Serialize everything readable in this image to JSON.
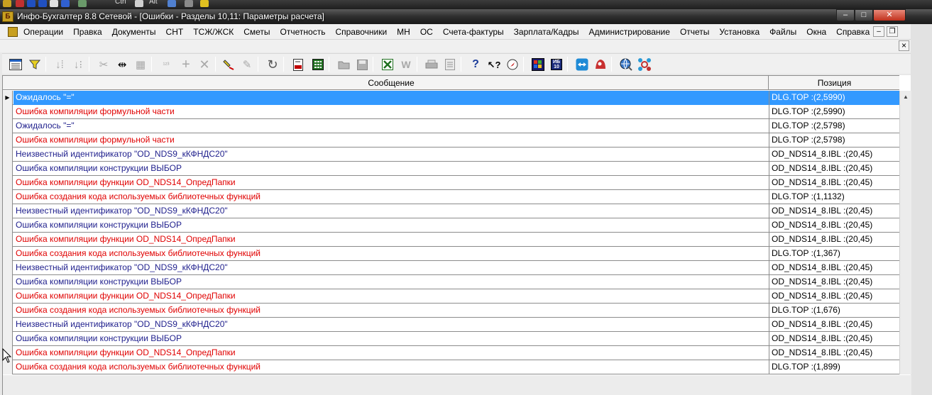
{
  "window": {
    "title": "Инфо-Бухгалтер 8.8 Сетевой - [Ошибки - Разделы 10,11: Параметры расчета]",
    "app_icon_text": "Б",
    "minimize_glyph": "–",
    "maximize_glyph": "□",
    "close_glyph": "✕"
  },
  "topstrip": {
    "items": [
      "Ctrl",
      "Alt"
    ]
  },
  "menu": {
    "items": [
      "Операции",
      "Правка",
      "Документы",
      "СНТ",
      "ТСЖ/ЖСК",
      "Сметы",
      "Отчетность",
      "Справочники",
      "МН",
      "ОС",
      "Счета-фактуры",
      "Зарплата/Кадры",
      "Администрирование",
      "Отчеты",
      "Установка",
      "Файлы",
      "Окна",
      "Справка"
    ],
    "mdi_minimize": "–",
    "mdi_restore": "❐",
    "mdi_close": "×"
  },
  "toolbar": {
    "icons": [
      "grid-view-icon",
      "filter-icon",
      "sort-asc-icon",
      "sort-desc-icon",
      "cut-icon",
      "split-icon",
      "paste-icon",
      "numbering-icon",
      "add-icon",
      "delete-icon",
      "highlight-icon",
      "clear-format-icon",
      "refresh-icon",
      "pdf-icon",
      "calculator-icon",
      "open-folder-icon",
      "save-icon",
      "excel-icon",
      "word-icon",
      "print-icon",
      "print-preview-icon",
      "help-icon",
      "whats-this-icon",
      "compass-icon",
      "windows-flag-icon",
      "ib10-icon",
      "teamviewer-icon",
      "ammy-icon",
      "globe-icon",
      "network-icon"
    ],
    "ib_label": "ИБ 10"
  },
  "grid": {
    "columns": [
      "Сообщение",
      "Позиция"
    ],
    "current_row_marker": "▶",
    "rows": [
      {
        "message": "Ожидалось \"=\"",
        "position": "DLG.TOP :(2,5990)",
        "color": "#1e1e8c",
        "selected": true
      },
      {
        "message": "Ошибка компиляции формульной части",
        "position": "DLG.TOP :(2,5990)",
        "color": "#e00000"
      },
      {
        "message": "Ожидалось \"=\"",
        "position": "DLG.TOP :(2,5798)",
        "color": "#1e1e8c"
      },
      {
        "message": "Ошибка компиляции формульной части",
        "position": "DLG.TOP :(2,5798)",
        "color": "#e00000"
      },
      {
        "message": "Неизвестный идентификатор \"OD_NDS9_кКФНДС20\"",
        "position": "OD_NDS14_8.IBL :(20,45)",
        "color": "#1e1e8c"
      },
      {
        "message": "Ошибка компиляции конструкции ВЫБОР",
        "position": "OD_NDS14_8.IBL :(20,45)",
        "color": "#1e1e8c"
      },
      {
        "message": "Ошибка компиляции функции OD_NDS14_ОпредПапки",
        "position": "OD_NDS14_8.IBL :(20,45)",
        "color": "#e00000"
      },
      {
        "message": "Ошибка создания кода используемых библиотечных функций",
        "position": "DLG.TOP :(1,1132)",
        "color": "#e00000"
      },
      {
        "message": "Неизвестный идентификатор \"OD_NDS9_кКФНДС20\"",
        "position": "OD_NDS14_8.IBL :(20,45)",
        "color": "#1e1e8c"
      },
      {
        "message": "Ошибка компиляции конструкции ВЫБОР",
        "position": "OD_NDS14_8.IBL :(20,45)",
        "color": "#1e1e8c"
      },
      {
        "message": "Ошибка компиляции функции OD_NDS14_ОпредПапки",
        "position": "OD_NDS14_8.IBL :(20,45)",
        "color": "#e00000"
      },
      {
        "message": "Ошибка создания кода используемых библиотечных функций",
        "position": "DLG.TOP :(1,367)",
        "color": "#e00000"
      },
      {
        "message": "Неизвестный идентификатор \"OD_NDS9_кКФНДС20\"",
        "position": "OD_NDS14_8.IBL :(20,45)",
        "color": "#1e1e8c"
      },
      {
        "message": "Ошибка компиляции конструкции ВЫБОР",
        "position": "OD_NDS14_8.IBL :(20,45)",
        "color": "#1e1e8c"
      },
      {
        "message": "Ошибка компиляции функции OD_NDS14_ОпредПапки",
        "position": "OD_NDS14_8.IBL :(20,45)",
        "color": "#e00000"
      },
      {
        "message": "Ошибка создания кода используемых библиотечных функций",
        "position": "DLG.TOP :(1,676)",
        "color": "#e00000"
      },
      {
        "message": "Неизвестный идентификатор \"OD_NDS9_кКФНДС20\"",
        "position": "OD_NDS14_8.IBL :(20,45)",
        "color": "#1e1e8c"
      },
      {
        "message": "Ошибка компиляции конструкции ВЫБОР",
        "position": "OD_NDS14_8.IBL :(20,45)",
        "color": "#1e1e8c"
      },
      {
        "message": "Ошибка компиляции функции OD_NDS14_ОпредПапки",
        "position": "OD_NDS14_8.IBL :(20,45)",
        "color": "#e00000"
      },
      {
        "message": "Ошибка создания кода используемых библиотечных функций",
        "position": "DLG.TOP :(1,899)",
        "color": "#e00000"
      }
    ]
  },
  "scrollbar": {
    "up_arrow": "▲"
  }
}
